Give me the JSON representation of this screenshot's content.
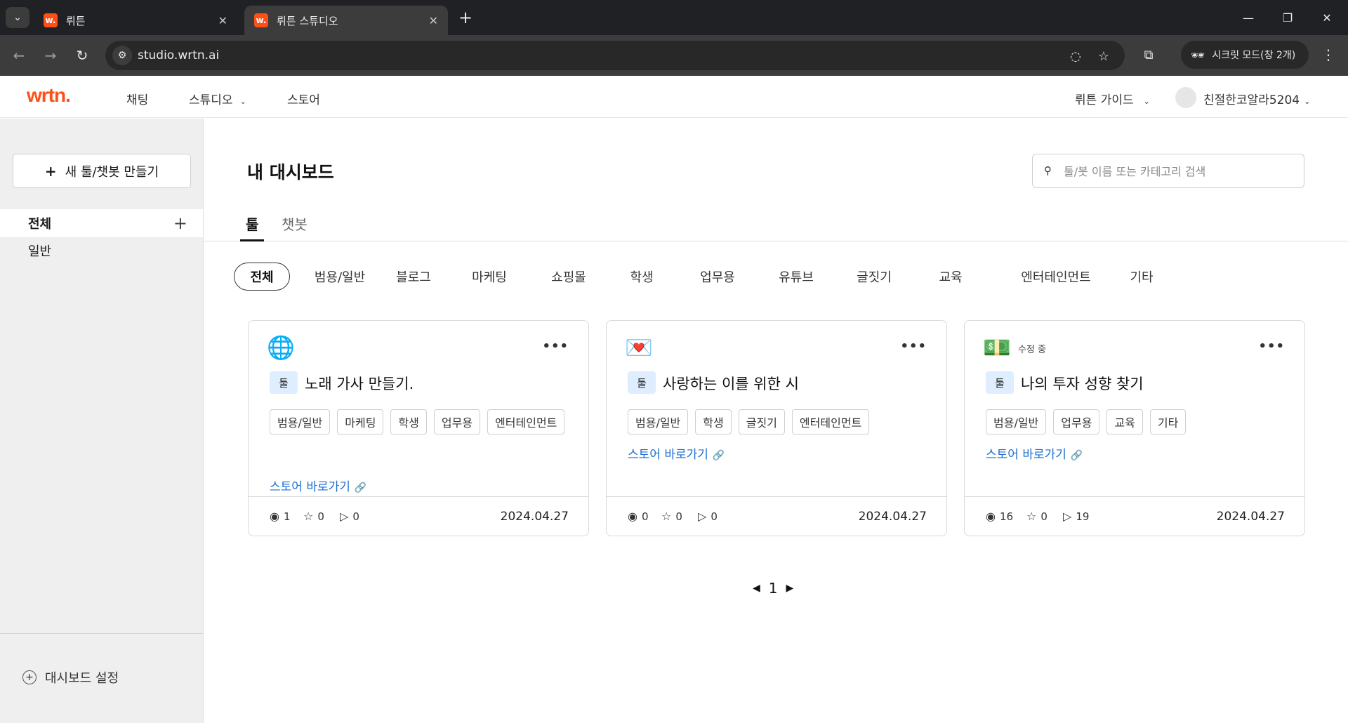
{
  "browser": {
    "tabs": [
      {
        "favicon": "w.",
        "title": "뤼튼",
        "close": "✕"
      },
      {
        "favicon": "w.",
        "title": "뤼튼 스튜디오",
        "close": "✕"
      }
    ],
    "new_tab": "+",
    "url": "studio.wrtn.ai",
    "incognito_label": "시크릿 모드(창 2개)",
    "window_controls": {
      "minimize": "—",
      "restore": "❐",
      "close": "✕"
    }
  },
  "header": {
    "logo": "wrtn.",
    "nav": [
      "채팅",
      "스튜디오",
      "스토어"
    ],
    "guide": "뤼튼 가이드",
    "user": "친절한코알라5204"
  },
  "sidebar": {
    "new_button": "새 툴/챗봇 만들기",
    "items": [
      "전체",
      "일반"
    ],
    "settings": "대시보드 설정"
  },
  "main": {
    "title": "내 대시보드",
    "search_placeholder": "툴/봇 이름 또는 카테고리 검색",
    "tabs": [
      "툴",
      "챗봇"
    ],
    "categories": [
      "전체",
      "범용/일반",
      "블로그",
      "마케팅",
      "쇼핑몰",
      "학생",
      "업무용",
      "유튜브",
      "글짓기",
      "교육",
      "엔터테인먼트",
      "기타"
    ],
    "cards": [
      {
        "icon": "globe-icon",
        "emoji": "🌐",
        "status": "",
        "type": "툴",
        "name": "노래 가사 만들기.",
        "tags": [
          "범용/일반",
          "마케팅",
          "학생",
          "업무용",
          "엔터테인먼트"
        ],
        "store_link": "스토어 바로가기",
        "views": "1",
        "likes": "0",
        "runs": "0",
        "date": "2024.04.27"
      },
      {
        "icon": "love-letter-icon",
        "emoji": "💌",
        "status": "",
        "type": "툴",
        "name": "사랑하는 이를 위한 시",
        "tags": [
          "범용/일반",
          "학생",
          "글짓기",
          "엔터테인먼트"
        ],
        "store_link": "스토어 바로가기",
        "views": "0",
        "likes": "0",
        "runs": "0",
        "date": "2024.04.27"
      },
      {
        "icon": "dollar-bill-icon",
        "emoji": "💵",
        "status": "수정 중",
        "type": "툴",
        "name": "나의 투자 성향 찾기",
        "tags": [
          "범용/일반",
          "업무용",
          "교육",
          "기타"
        ],
        "store_link": "스토어 바로가기",
        "views": "16",
        "likes": "0",
        "runs": "19",
        "date": "2024.04.27"
      }
    ],
    "pagination": {
      "current": "1"
    }
  },
  "colors": {
    "brand": "#ff4f17",
    "link": "#1b6fd1",
    "badge_bg": "#deeeff"
  }
}
